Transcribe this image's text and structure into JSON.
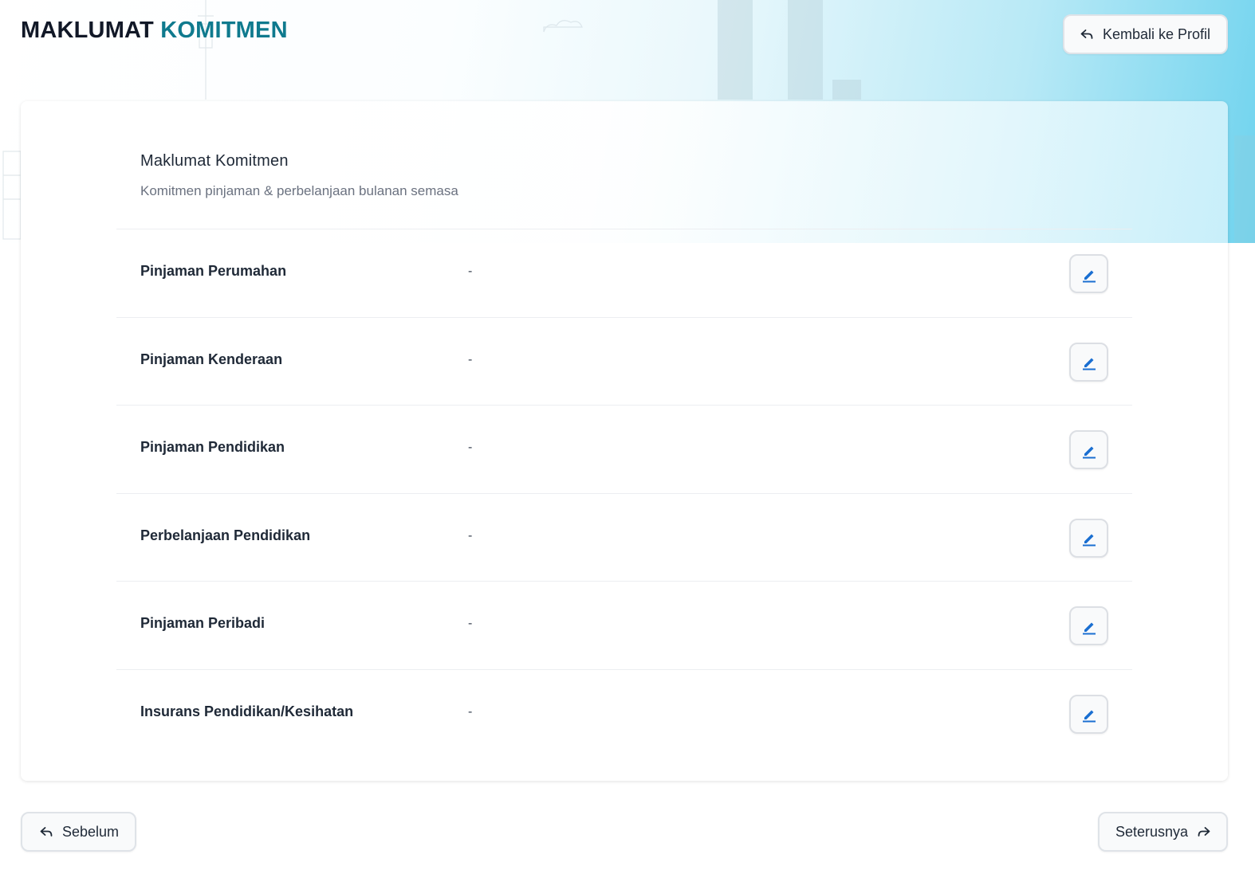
{
  "header": {
    "title_part1": "MAKLUMAT",
    "title_part2": "KOMITMEN",
    "back_to_profile_label": "Kembali ke Profil"
  },
  "section": {
    "title": "Maklumat Komitmen",
    "subtitle": "Komitmen pinjaman & perbelanjaan bulanan semasa"
  },
  "rows": [
    {
      "label": "Pinjaman Perumahan",
      "value": "-"
    },
    {
      "label": "Pinjaman Kenderaan",
      "value": "-"
    },
    {
      "label": "Pinjaman Pendidikan",
      "value": "-"
    },
    {
      "label": "Perbelanjaan Pendidikan",
      "value": "-"
    },
    {
      "label": "Pinjaman Peribadi",
      "value": "-"
    },
    {
      "label": "Insurans Pendidikan/Kesihatan",
      "value": "-"
    }
  ],
  "footer": {
    "prev_label": "Sebelum",
    "next_label": "Seterusnya"
  },
  "colors": {
    "title_accent": "#0f7a8e",
    "edit_icon": "#1a6fd1"
  },
  "icons": {
    "back": "reply-arrow-icon",
    "edit": "pencil-icon",
    "next": "forward-arrow-icon"
  }
}
